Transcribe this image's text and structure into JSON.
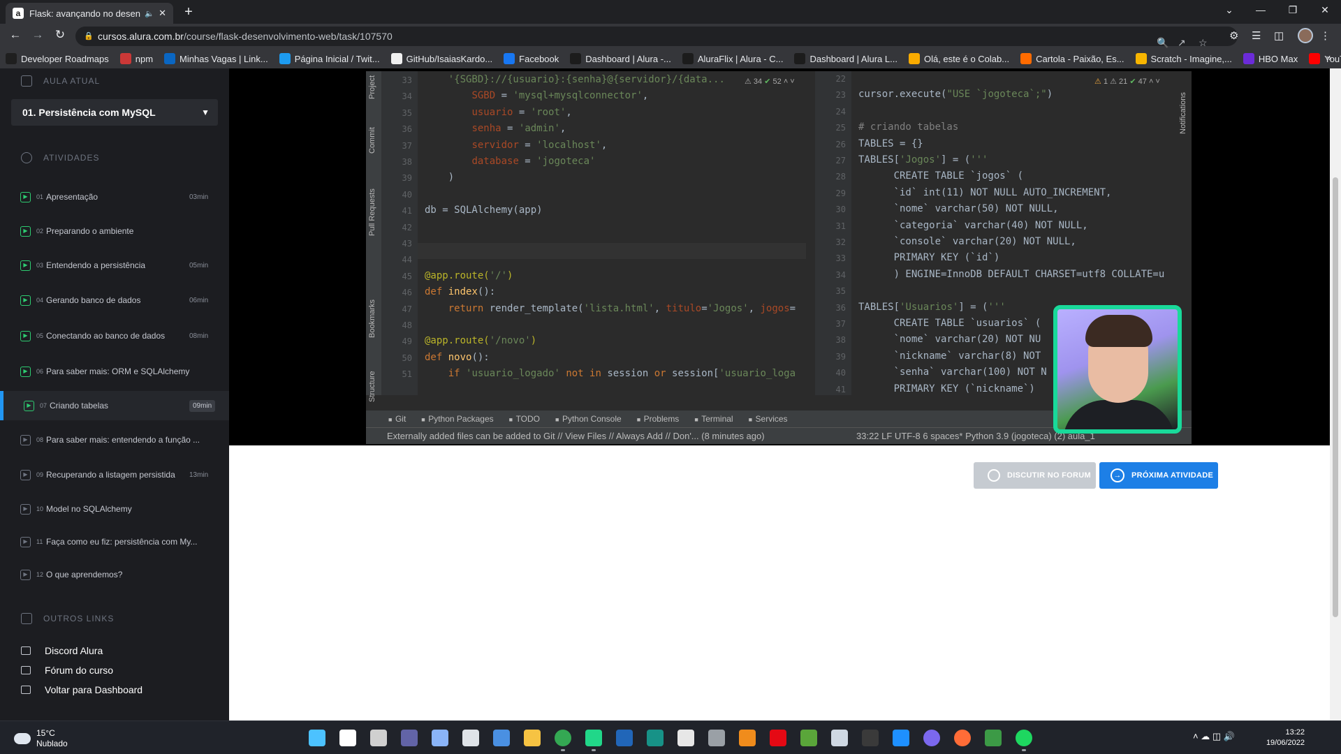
{
  "browser": {
    "tab_title": "Flask: avançando no desenvo",
    "tab_favicon": "a",
    "url_host": "cursos.alura.com.br",
    "url_path": "/course/flask-desenvolvimento-web/task/107570",
    "bookmarks": [
      {
        "label": "Developer Roadmaps",
        "icon": "roadmap-icon",
        "color": "#1f1f1f"
      },
      {
        "label": "npm",
        "icon": "npm-icon",
        "color": "#cb3837"
      },
      {
        "label": "Minhas Vagas | Link...",
        "icon": "linkedin-icon",
        "color": "#0a66c2"
      },
      {
        "label": "Página Inicial / Twit...",
        "icon": "twitter-icon",
        "color": "#1d9bf0"
      },
      {
        "label": "GitHub/IsaiasKardo...",
        "icon": "github-icon",
        "color": "#f0f0f0"
      },
      {
        "label": "Facebook",
        "icon": "facebook-icon",
        "color": "#1877f2"
      },
      {
        "label": "Dashboard | Alura -...",
        "icon": "alura-icon",
        "color": "#1c1c1c"
      },
      {
        "label": "AluraFlix | Alura - C...",
        "icon": "alura-icon",
        "color": "#1c1c1c"
      },
      {
        "label": "Dashboard | Alura L...",
        "icon": "alura-icon",
        "color": "#1c1c1c"
      },
      {
        "label": "Olá, este é o Colab...",
        "icon": "colab-icon",
        "color": "#f9ab00"
      },
      {
        "label": "Cartola - Paixão, Es...",
        "icon": "cartola-icon",
        "color": "#ff6b00"
      },
      {
        "label": "Scratch - Imagine,...",
        "icon": "scratch-icon",
        "color": "#f7b500"
      },
      {
        "label": "HBO Max",
        "icon": "hbo-icon",
        "color": "#6b2bd8"
      },
      {
        "label": "YouTube",
        "icon": "youtube-icon",
        "color": "#ff0000"
      }
    ]
  },
  "sidebar": {
    "current_lesson_heading": "AULA ATUAL",
    "course_select": "01. Persistência com MySQL",
    "activities_heading": "ATIVIDADES",
    "activities": [
      {
        "num": "01",
        "label": "Apresentação",
        "duration": "03min",
        "done": true
      },
      {
        "num": "02",
        "label": "Preparando o ambiente",
        "duration": "",
        "done": true
      },
      {
        "num": "03",
        "label": "Entendendo a persistência",
        "duration": "05min",
        "done": true
      },
      {
        "num": "04",
        "label": "Gerando banco de dados",
        "duration": "06min",
        "done": true
      },
      {
        "num": "05",
        "label": "Conectando ao banco de dados",
        "duration": "08min",
        "done": true
      },
      {
        "num": "06",
        "label": "Para saber mais: ORM e SQLAlchemy",
        "duration": "",
        "done": true
      },
      {
        "num": "07",
        "label": "Criando tabelas",
        "duration": "09min",
        "done": true,
        "current": true
      },
      {
        "num": "08",
        "label": "Para saber mais: entendendo a função ...",
        "duration": "",
        "done": false
      },
      {
        "num": "09",
        "label": "Recuperando a listagem persistida",
        "duration": "13min",
        "done": false
      },
      {
        "num": "10",
        "label": "Model no SQLAlchemy",
        "duration": "",
        "done": false
      },
      {
        "num": "11",
        "label": "Faça como eu fiz: persistência com My...",
        "duration": "",
        "done": false
      },
      {
        "num": "12",
        "label": "O que aprendemos?",
        "duration": "",
        "done": false
      }
    ],
    "other_links_heading": "OUTROS LINKS",
    "links": [
      "Discord Alura",
      "Fórum do curso",
      "Voltar para Dashboard"
    ]
  },
  "ide": {
    "left_tabs": [
      "Project",
      "Commit",
      "Pull Requests",
      "Bookmarks",
      "Structure"
    ],
    "left_inspections": {
      "warnings": "34",
      "ok": "52"
    },
    "right_inspections": {
      "errors": "1",
      "warnings": "21",
      "ok": "47"
    },
    "right_side_tab": "Notifications",
    "left_lines": [
      {
        "n": "33",
        "html": "    <span class=\"str\">'{SGBD}://{usuario}:{senha}@{servidor}/{data...</span>"
      },
      {
        "n": "34",
        "html": "        <span class=\"param\">SGBD</span> = <span class=\"str\">'mysql+mysqlconnector'</span>,"
      },
      {
        "n": "35",
        "html": "        <span class=\"param\">usuario</span> = <span class=\"str\">'root'</span>,"
      },
      {
        "n": "36",
        "html": "        <span class=\"param\">senha</span> = <span class=\"str\">'admin'</span>,"
      },
      {
        "n": "37",
        "html": "        <span class=\"param\">servidor</span> = <span class=\"str\">'localhost'</span>,"
      },
      {
        "n": "38",
        "html": "        <span class=\"param\">database</span> = <span class=\"str\">'jogoteca'</span>"
      },
      {
        "n": "39",
        "html": "    )"
      },
      {
        "n": "40",
        "html": ""
      },
      {
        "n": "41",
        "html": "db = SQLAlchemy(app)"
      },
      {
        "n": "42",
        "html": ""
      },
      {
        "n": "43",
        "html": ""
      },
      {
        "n": "44",
        "html": ""
      },
      {
        "n": "45",
        "html": "<span class=\"dec\">@app.route(<span class=\"str\">'/'</span>)</span>"
      },
      {
        "n": "46",
        "html": "<span class=\"kw\">def</span> <span class=\"fn\">index</span>():"
      },
      {
        "n": "47",
        "html": "    <span class=\"kw\">return</span> render_template(<span class=\"str\">'lista.html'</span>, <span class=\"param\">titulo</span>=<span class=\"str\">'Jogos'</span>, <span class=\"param\">jogos</span>="
      },
      {
        "n": "48",
        "html": ""
      },
      {
        "n": "49",
        "html": "<span class=\"dec\">@app.route(<span class=\"str\">'/novo'</span>)</span>"
      },
      {
        "n": "50",
        "html": "<span class=\"kw\">def</span> <span class=\"fn\">novo</span>():"
      },
      {
        "n": "51",
        "html": "    <span class=\"kw\">if</span> <span class=\"str\">'usuario_logado'</span> <span class=\"kw\">not in</span> session <span class=\"kw\">or</span> session[<span class=\"str\">'usuario_loga</span>"
      }
    ],
    "right_lines": [
      {
        "n": "22",
        "html": ""
      },
      {
        "n": "23",
        "html": "cursor.execute(<span class=\"str\">\"USE `jogoteca`;\"</span>)"
      },
      {
        "n": "24",
        "html": ""
      },
      {
        "n": "25",
        "html": "<span class=\"cm\"># criando tabelas</span>"
      },
      {
        "n": "26",
        "html": "TABLES = {}"
      },
      {
        "n": "27",
        "html": "TABLES[<span class=\"str\">'Jogos'</span>] = (<span class=\"str\">'''</span>"
      },
      {
        "n": "28",
        "html": "      CREATE TABLE `jogos` ("
      },
      {
        "n": "29",
        "html": "      `id` int(11) NOT NULL AUTO_INCREMENT,"
      },
      {
        "n": "30",
        "html": "      `nome` varchar(50) NOT NULL,"
      },
      {
        "n": "31",
        "html": "      `categoria` varchar(40) NOT NULL,"
      },
      {
        "n": "32",
        "html": "      `console` varchar(20) NOT NULL,"
      },
      {
        "n": "33",
        "html": "      PRIMARY KEY (`id`)"
      },
      {
        "n": "34",
        "html": "      ) ENGINE=InnoDB DEFAULT CHARSET=utf8 COLLATE=u"
      },
      {
        "n": "35",
        "html": ""
      },
      {
        "n": "36",
        "html": "TABLES[<span class=\"str\">'Usuarios'</span>] = (<span class=\"str\">'''</span>"
      },
      {
        "n": "37",
        "html": "      CREATE TABLE `usuarios` ("
      },
      {
        "n": "38",
        "html": "      `nome` varchar(20) NOT NU"
      },
      {
        "n": "39",
        "html": "      `nickname` varchar(8) NOT"
      },
      {
        "n": "40",
        "html": "      `senha` varchar(100) NOT N"
      },
      {
        "n": "41",
        "html": "      PRIMARY KEY (`nickname`)"
      }
    ],
    "toolbar": [
      "Git",
      "Python Packages",
      "TODO",
      "Python Console",
      "Problems",
      "Terminal",
      "Services"
    ],
    "status_message": "Externally added files can be added to Git // View Files // Always Add // Don'... (8 minutes ago)",
    "status_right": "33:22   LF   UTF-8   6 spaces*   Python 3.9 (jogoteca) (2)   aula_1"
  },
  "page": {
    "forum_button": "DISCUTIR NO FORUM",
    "next_button": "PRÓXIMA ATIVIDADE"
  },
  "taskbar": {
    "temperature": "15°C",
    "weather": "Nublado",
    "time": "13:22",
    "date": "19/06/2022"
  },
  "colors": {
    "accent": "#1d7fe6",
    "done_green": "#2ecc71",
    "webcam_border": "#19d99a",
    "sidebar_bg": "#1c1d21"
  }
}
